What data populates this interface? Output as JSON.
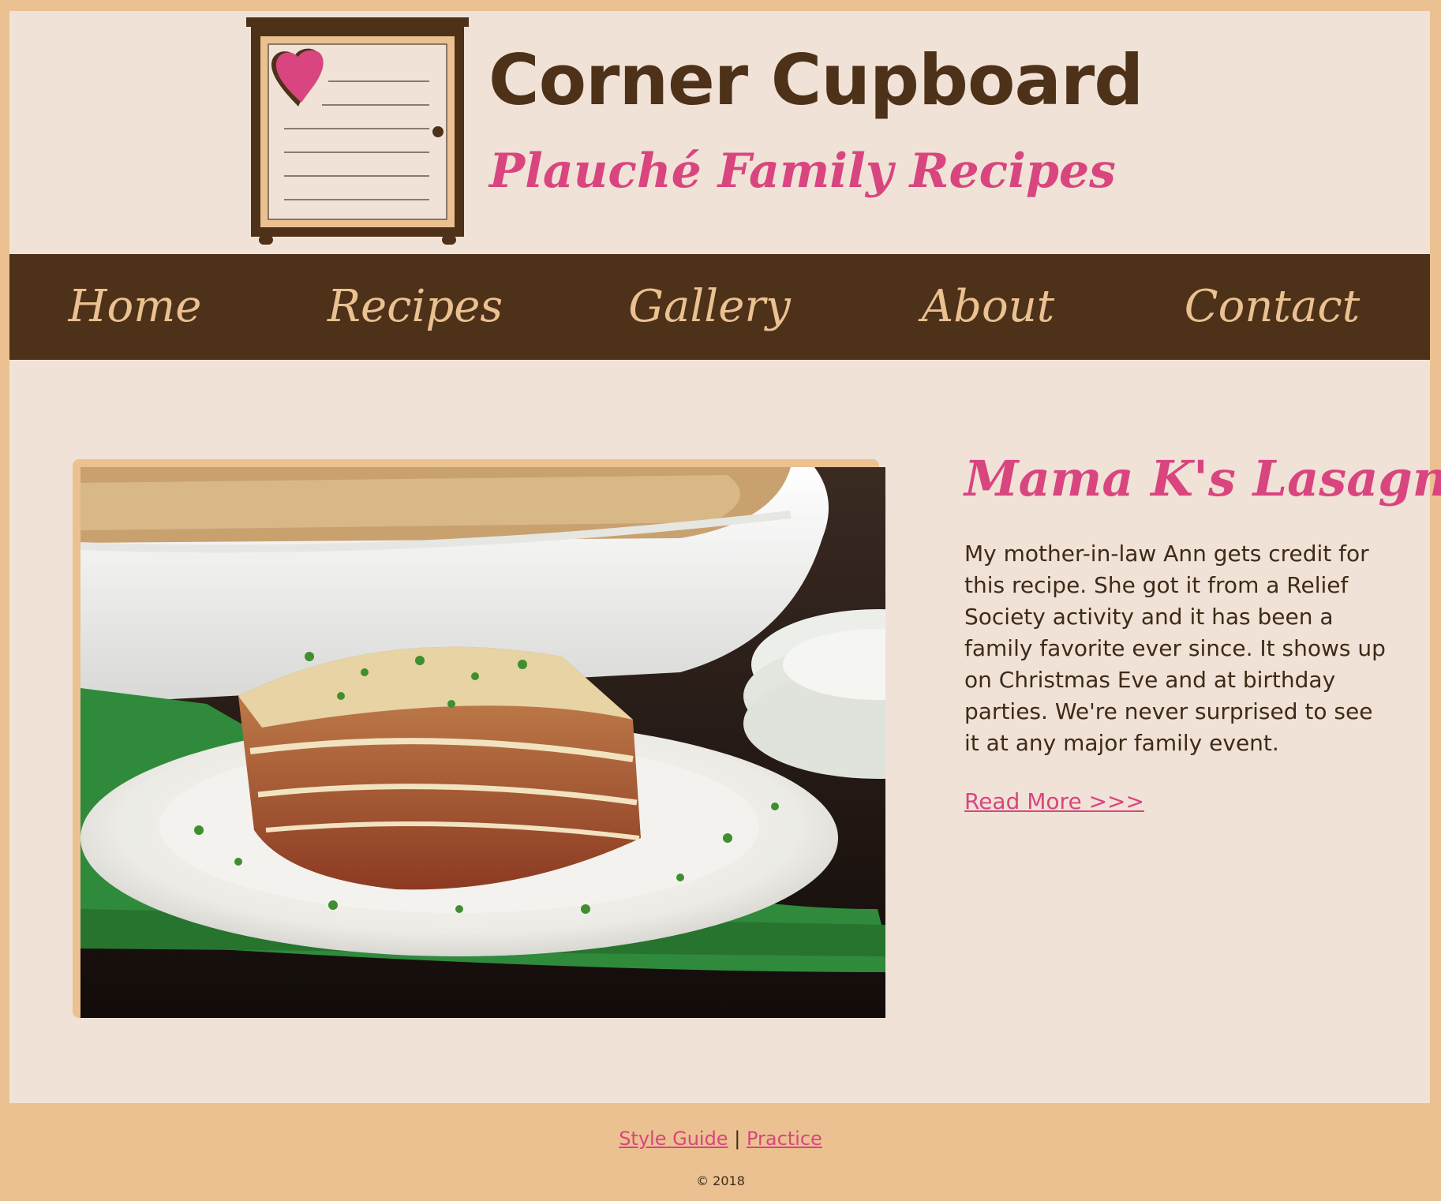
{
  "header": {
    "title": "Corner Cupboard",
    "subtitle": "Plauché Family Recipes",
    "logo_icon": "cupboard-heart-icon"
  },
  "nav": {
    "items": [
      {
        "label": "Home"
      },
      {
        "label": "Recipes"
      },
      {
        "label": "Gallery"
      },
      {
        "label": "About"
      },
      {
        "label": "Contact"
      }
    ]
  },
  "featured": {
    "image": "lasagna-photo",
    "title": "Mama K's Lasagna",
    "description": "My mother-in-law Ann gets credit for this recipe. She got it from a Relief Society activity and it has been a family favorite ever since. It shows up on Christmas Eve and at birthday parties. We're never surprised to see it at any major family event.",
    "read_more": "Read More >>>"
  },
  "footer": {
    "links": [
      {
        "label": "Style Guide"
      },
      {
        "label": "Practice"
      }
    ],
    "separator": "|",
    "copyright": "© 2018"
  },
  "colors": {
    "background_outer": "#EBC191",
    "background_inner": "#F0E2D6",
    "brown": "#4E3119",
    "pink": "#D9457F"
  }
}
